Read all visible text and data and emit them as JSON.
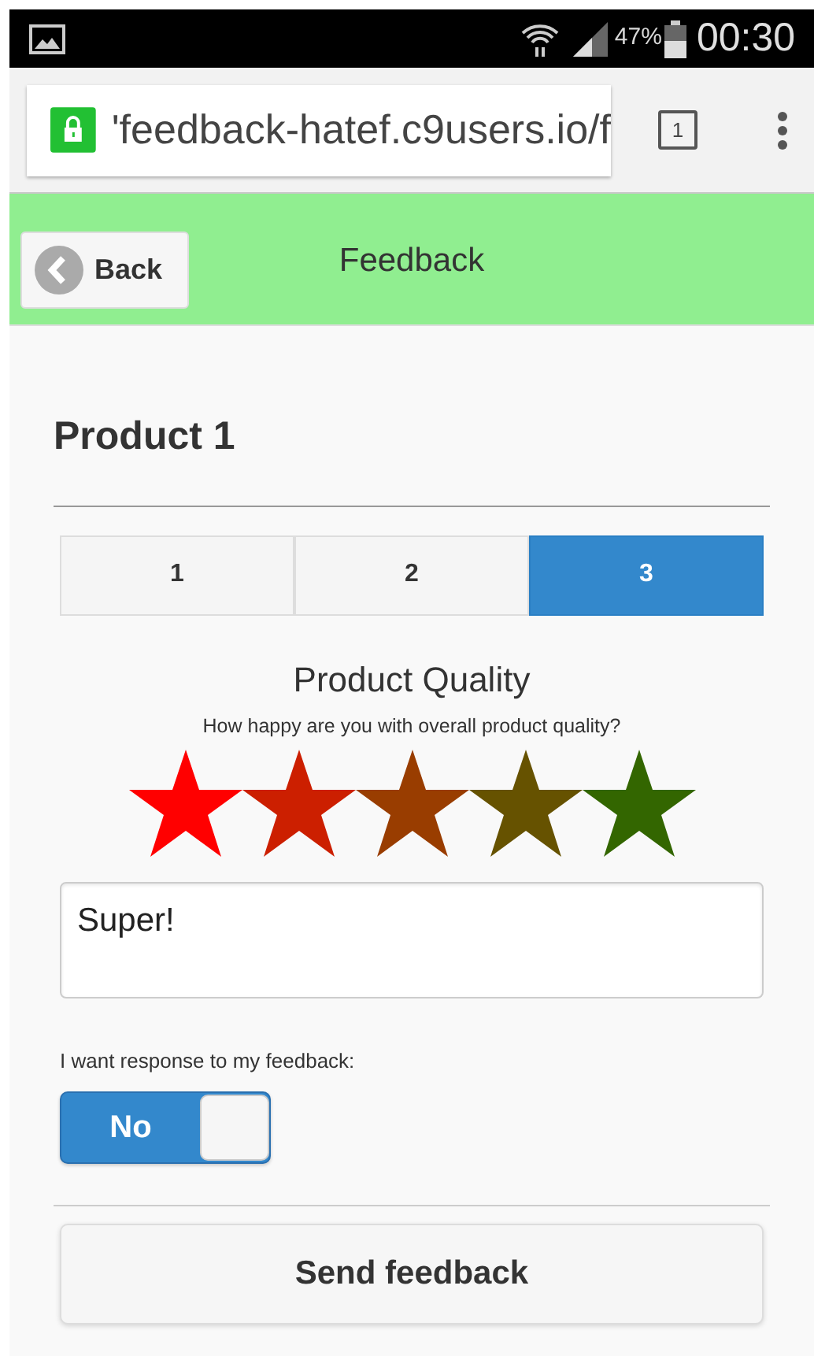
{
  "status_bar": {
    "battery_percent": "47%",
    "time": "00:30"
  },
  "browser": {
    "url": "'feedback-hatef.c9users.io/f",
    "tab_count": "1"
  },
  "header": {
    "back_label": "Back",
    "title": "Feedback"
  },
  "product": {
    "title": "Product 1"
  },
  "tabs": [
    {
      "label": "1",
      "selected": false
    },
    {
      "label": "2",
      "selected": false
    },
    {
      "label": "3",
      "selected": true
    }
  ],
  "question": {
    "title": "Product Quality",
    "text": "How happy are you with overall product quality?"
  },
  "rating": {
    "items": [
      {
        "color": "#ff0000"
      },
      {
        "color": "#cc1f00"
      },
      {
        "color": "#993d00"
      },
      {
        "color": "#665200"
      },
      {
        "color": "#336600"
      }
    ]
  },
  "comment": {
    "value": "Super!"
  },
  "response": {
    "label": "I want response to my feedback:",
    "toggle_label": "No",
    "on": false
  },
  "send_button": "Send feedback"
}
